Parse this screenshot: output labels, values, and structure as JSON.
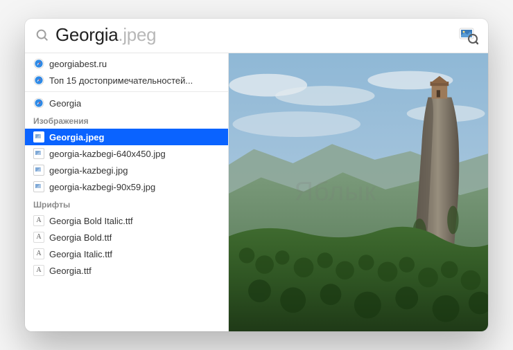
{
  "search": {
    "typed": "Georgia",
    "completion": ".jpeg"
  },
  "results": {
    "web": [
      {
        "label": "georgiabest.ru"
      },
      {
        "label": "Топ 15 достопримечательностей..."
      }
    ],
    "top_hit": [
      {
        "label": "Georgia"
      }
    ],
    "sections": [
      {
        "header": "Изображения",
        "kind": "image",
        "items": [
          {
            "label": "Georgia.jpeg",
            "selected": true
          },
          {
            "label": "georgia-kazbegi-640x450.jpg"
          },
          {
            "label": "georgia-kazbegi.jpg"
          },
          {
            "label": "georgia-kazbegi-90x59.jpg"
          }
        ]
      },
      {
        "header": "Шрифты",
        "kind": "font",
        "items": [
          {
            "label": "Georgia Bold Italic.ttf"
          },
          {
            "label": "Georgia Bold.ttf"
          },
          {
            "label": "Georgia Italic.ttf"
          },
          {
            "label": "Georgia.ttf"
          }
        ]
      }
    ]
  },
  "watermark": "Яблык"
}
